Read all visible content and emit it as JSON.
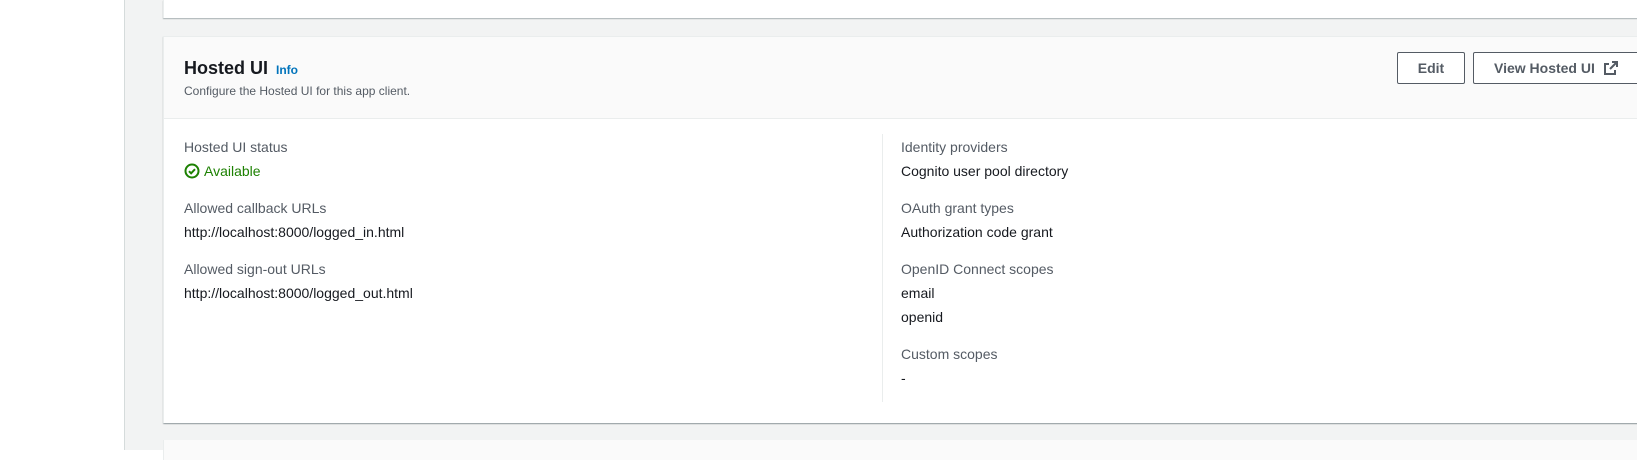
{
  "panel": {
    "title": "Hosted UI",
    "info_link": "Info",
    "description": "Configure the Hosted UI for this app client.",
    "edit_button": "Edit",
    "view_button": "View Hosted UI",
    "view_button_icon": "external-link-icon"
  },
  "left_column": {
    "status": {
      "label": "Hosted UI status",
      "value": "Available",
      "icon": "check-circle-icon",
      "color": "#1d8102"
    },
    "callback_urls": {
      "label": "Allowed callback URLs",
      "values": [
        "http://localhost:8000/logged_in.html"
      ]
    },
    "signout_urls": {
      "label": "Allowed sign-out URLs",
      "values": [
        "http://localhost:8000/logged_out.html"
      ]
    }
  },
  "right_column": {
    "identity_providers": {
      "label": "Identity providers",
      "values": [
        "Cognito user pool directory"
      ]
    },
    "oauth_grant_types": {
      "label": "OAuth grant types",
      "values": [
        "Authorization code grant"
      ]
    },
    "openid_scopes": {
      "label": "OpenID Connect scopes",
      "values": [
        "email",
        "openid"
      ]
    },
    "custom_scopes": {
      "label": "Custom scopes",
      "values": [
        "-"
      ]
    }
  },
  "colors": {
    "link": "#0073bb",
    "success": "#1d8102",
    "label": "#545b64",
    "text": "#16191f"
  }
}
